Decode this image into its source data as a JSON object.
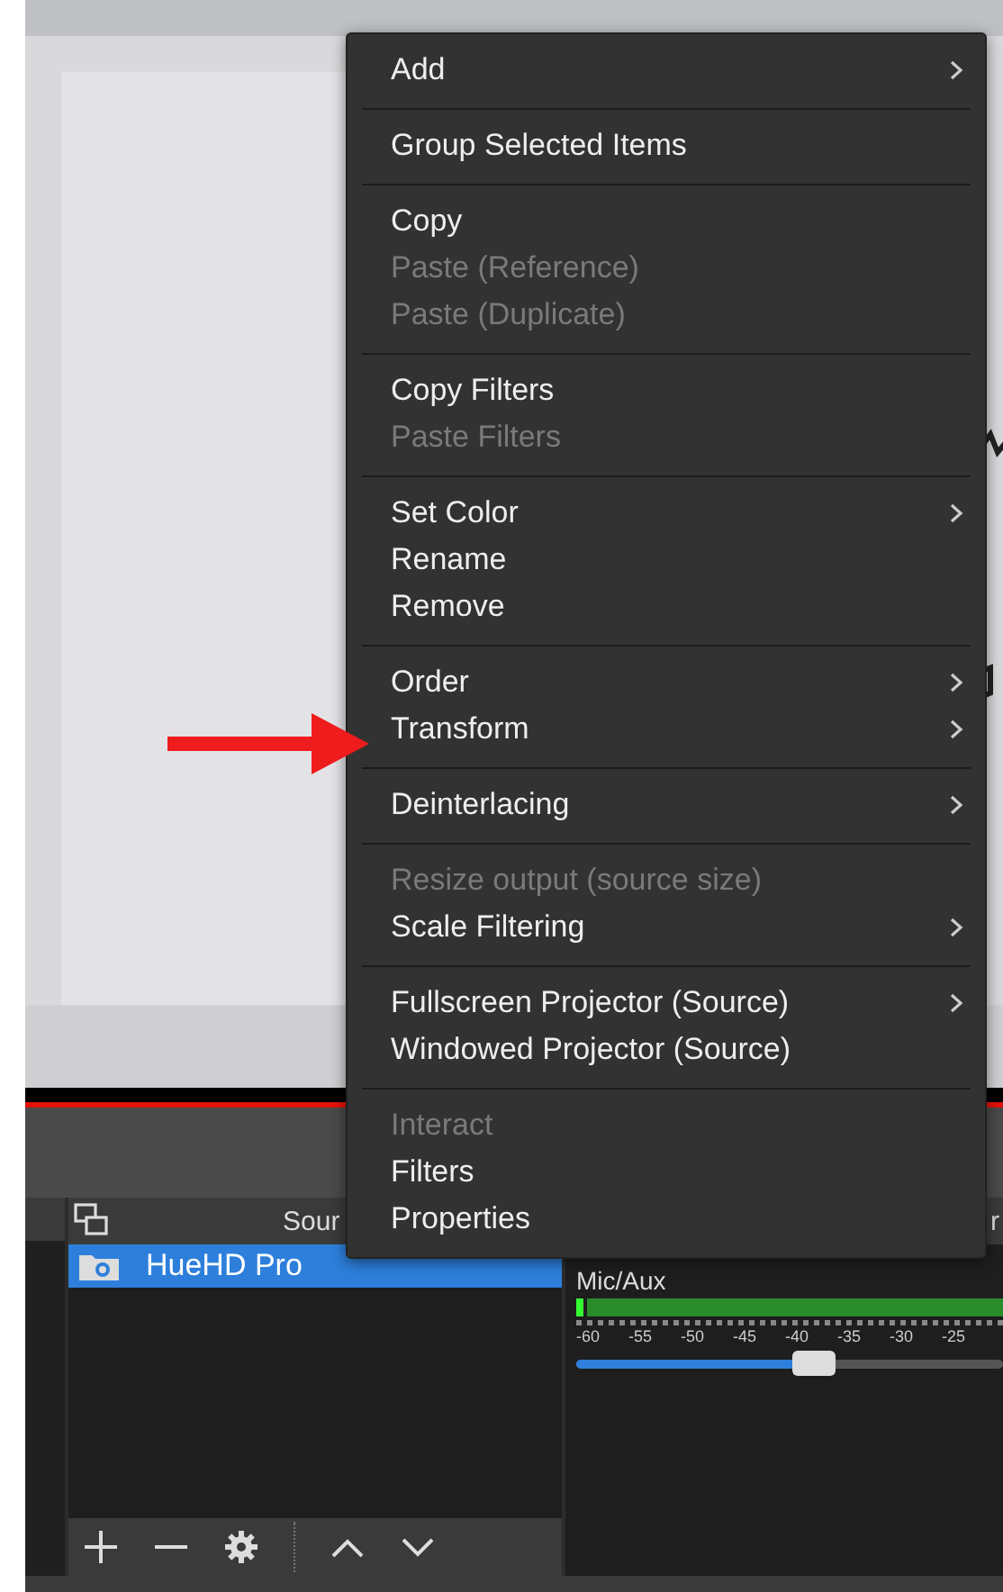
{
  "context_menu": {
    "groups": [
      [
        {
          "label": "Add",
          "disabled": false,
          "submenu": true
        }
      ],
      [
        {
          "label": "Group Selected Items",
          "disabled": false,
          "submenu": false
        }
      ],
      [
        {
          "label": "Copy",
          "disabled": false,
          "submenu": false
        },
        {
          "label": "Paste (Reference)",
          "disabled": true,
          "submenu": false
        },
        {
          "label": "Paste (Duplicate)",
          "disabled": true,
          "submenu": false
        }
      ],
      [
        {
          "label": "Copy Filters",
          "disabled": false,
          "submenu": false
        },
        {
          "label": "Paste Filters",
          "disabled": true,
          "submenu": false
        }
      ],
      [
        {
          "label": "Set Color",
          "disabled": false,
          "submenu": true
        },
        {
          "label": "Rename",
          "disabled": false,
          "submenu": false
        },
        {
          "label": "Remove",
          "disabled": false,
          "submenu": false
        }
      ],
      [
        {
          "label": "Order",
          "disabled": false,
          "submenu": true
        },
        {
          "label": "Transform",
          "disabled": false,
          "submenu": true
        }
      ],
      [
        {
          "label": "Deinterlacing",
          "disabled": false,
          "submenu": true
        }
      ],
      [
        {
          "label": "Resize output (source size)",
          "disabled": true,
          "submenu": false
        },
        {
          "label": "Scale Filtering",
          "disabled": false,
          "submenu": true
        }
      ],
      [
        {
          "label": "Fullscreen Projector (Source)",
          "disabled": false,
          "submenu": true
        },
        {
          "label": "Windowed Projector (Source)",
          "disabled": false,
          "submenu": false
        }
      ],
      [
        {
          "label": "Interact",
          "disabled": true,
          "submenu": false
        },
        {
          "label": "Filters",
          "disabled": false,
          "submenu": false
        },
        {
          "label": "Properties",
          "disabled": false,
          "submenu": false
        }
      ]
    ]
  },
  "sources": {
    "header": "Sour",
    "items": [
      {
        "name": "HueHD Pro",
        "selected": true
      }
    ]
  },
  "mixer": {
    "header": "r",
    "channels": [
      {
        "name": "Mic/Aux",
        "ticks": [
          "-60",
          "-55",
          "-50",
          "-45",
          "-40",
          "-35",
          "-30",
          "-25"
        ],
        "level": 0.55
      }
    ]
  }
}
